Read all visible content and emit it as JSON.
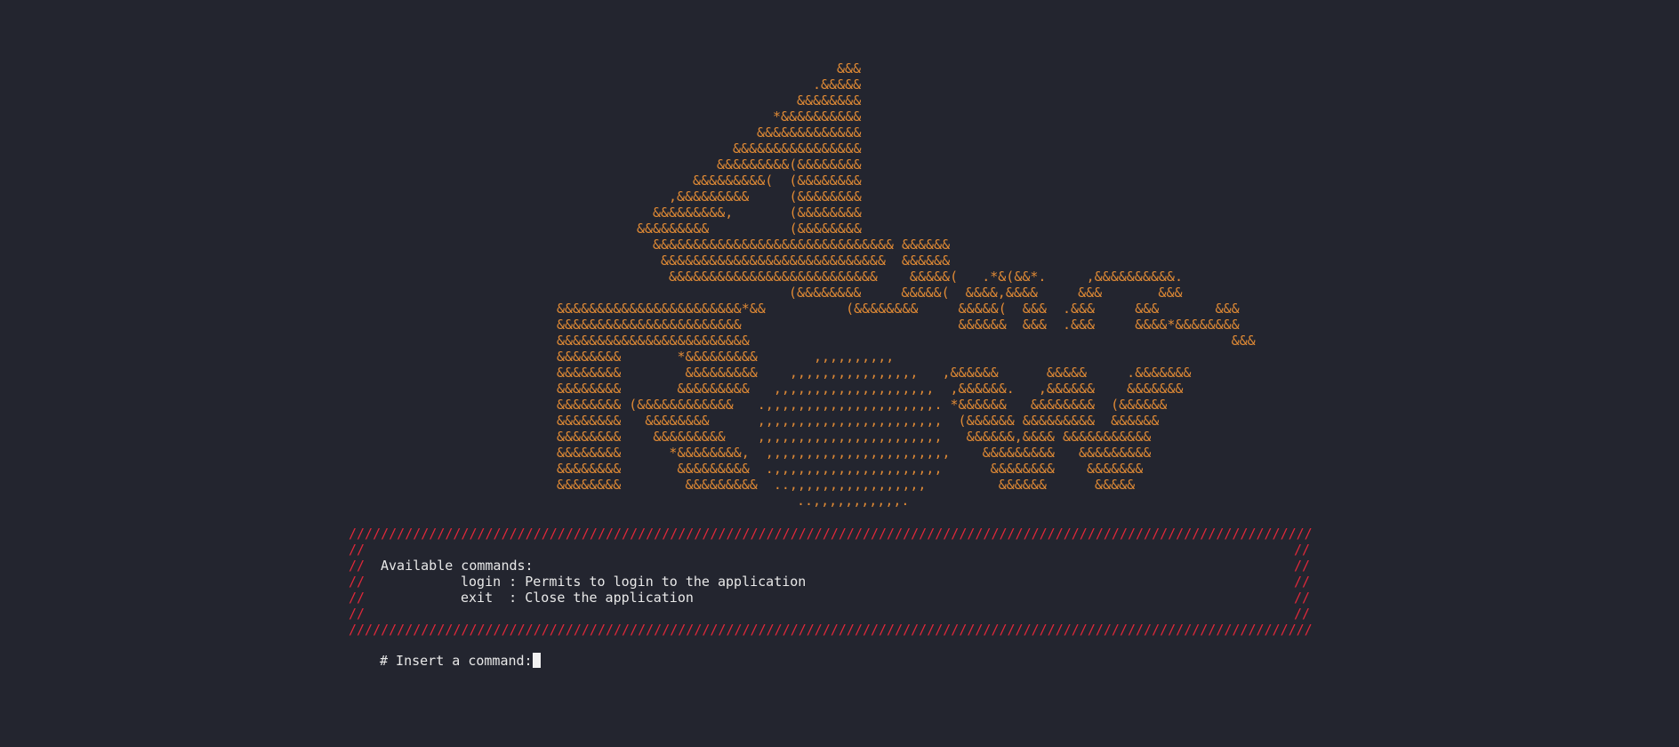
{
  "ascii_logo": [
    "&&&",
    ".&&&&&",
    "&&&&&&&&",
    "*&&&&&&&&&&",
    "&&&&&&&&&&&&&",
    "&&&&&&&&&&&&&&&&",
    "&&&&&&&&&(&&&&&&&&",
    "&&&&&&&&&(  (&&&&&&&&",
    ",&&&&&&&&&     (&&&&&&&&",
    "&&&&&&&&&,       (&&&&&&&&",
    "&&&&&&&&&          (&&&&&&&&",
    "&&&&&&&&&&&&&&&&&&&&&&&&&&&&&& &&&&&&",
    "&&&&&&&&&&&&&&&&&&&&&&&&&&&&  &&&&&&",
    "&&&&&&&&&&&&&&&&&&&&&&&&&&    &&&&&(   .*&(&&*.     ,&&&&&&&&&&.",
    "(&&&&&&&&     &&&&&(  &&&&,&&&&     &&&       &&&",
    "&&&&&&&&&&&&&&&&&&&&&&&*&&          (&&&&&&&&     &&&&&(  &&&  .&&&     &&&       &&&",
    "&&&&&&&&&&&&&&&&&&&&&&&                           &&&&&&  &&&  .&&&     &&&&*&&&&&&&&",
    "&&&&&&&&&&&&&&&&&&&&&&&&                                                            &&&",
    "&&&&&&&&       *&&&&&&&&&       ,,,,,,,,,,",
    "&&&&&&&&        &&&&&&&&&    ,,,,,,,,,,,,,,,,   ,&&&&&&      &&&&&     .&&&&&&&",
    "&&&&&&&&       &&&&&&&&&   ,,,,,,,,,,,,,,,,,,,,  ,&&&&&&.   ,&&&&&&    &&&&&&&",
    "&&&&&&&& (&&&&&&&&&&&&   .,,,,,,,,,,,,,,,,,,,,,. *&&&&&&   &&&&&&&&  (&&&&&&",
    "&&&&&&&&   &&&&&&&&      ,,,,,,,,,,,,,,,,,,,,,,,  (&&&&&& &&&&&&&&&  &&&&&&",
    "&&&&&&&&    &&&&&&&&&    ,,,,,,,,,,,,,,,,,,,,,,,   &&&&&&,&&&& &&&&&&&&&&&",
    "&&&&&&&&      *&&&&&&&&,  ,,,,,,,,,,,,,,,,,,,,,,,    &&&&&&&&&   &&&&&&&&&",
    "&&&&&&&&       &&&&&&&&&  .,,,,,,,,,,,,,,,,,,,,,      &&&&&&&&    &&&&&&&",
    "&&&&&&&&        &&&&&&&&&  ..,,,,,,,,,,,,,,,,,         &&&&&&      &&&&&",
    "..,,,,,,,,,,,."
  ],
  "commands_box": {
    "border_line": "////////////////////////////////////////////////////////////////////////////////////////////////////////////////////////",
    "comment_marker": "//",
    "title": "Available commands:",
    "commands": [
      "login : Permits to login to the application",
      "exit  : Close the application"
    ]
  },
  "prompt": {
    "label": "# Insert a command:",
    "value": ""
  },
  "colors": {
    "background": "#23252f",
    "logo": "#e08a35",
    "frame": "#e0283a",
    "text": "#e8e8e8"
  }
}
